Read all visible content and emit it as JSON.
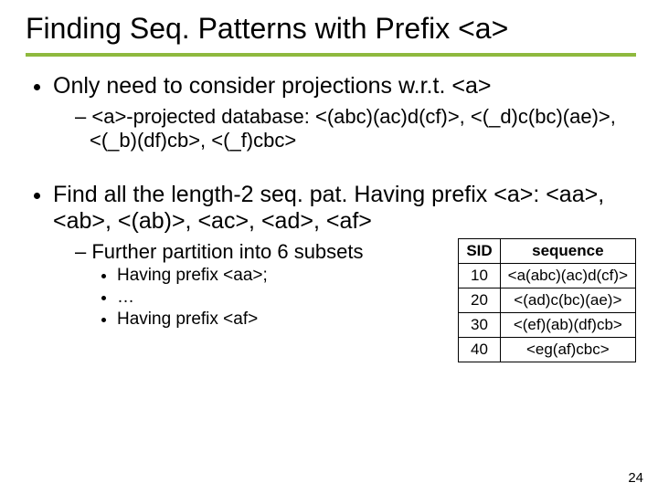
{
  "title": "Finding Seq. Patterns with Prefix <a>",
  "b1": {
    "text": "Only need to consider projections w.r.t. <a>",
    "sub": "<a>-projected database: <(abc)(ac)d(cf)>, <(_d)c(bc)(ae)>, <(_b)(df)cb>, <(_f)cbc>"
  },
  "b2": {
    "text": "Find all the length-2 seq. pat. Having prefix <a>: <aa>, <ab>, <(ab)>, <ac>, <ad>, <af>",
    "sub": "Further partition into 6 subsets",
    "subsub": {
      "i1": "Having prefix <aa>;",
      "i2": "…",
      "i3": "Having prefix <af>"
    }
  },
  "table": {
    "headers": {
      "c1": "SID",
      "c2": "sequence"
    },
    "rows": [
      {
        "sid": "10",
        "seq": "<a(abc)(ac)d(cf)>"
      },
      {
        "sid": "20",
        "seq": "<(ad)c(bc)(ae)>"
      },
      {
        "sid": "30",
        "seq": "<(ef)(ab)(df)cb>"
      },
      {
        "sid": "40",
        "seq": "<eg(af)cbc>"
      }
    ]
  },
  "pagenum": "24"
}
